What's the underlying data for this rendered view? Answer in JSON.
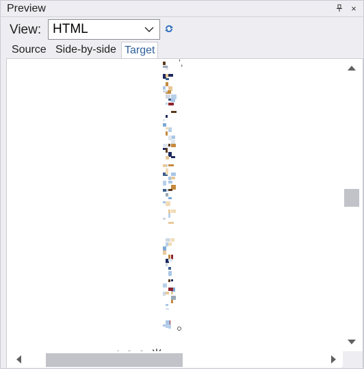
{
  "panel": {
    "title": "Preview",
    "pin_icon": "pin-icon",
    "close_icon": "close-icon"
  },
  "view": {
    "label": "View:",
    "selected": "HTML",
    "refresh_icon": "refresh-icon"
  },
  "tabs": [
    {
      "label": "Source",
      "active": false
    },
    {
      "label": "Side-by-side",
      "active": false
    },
    {
      "label": "Target",
      "active": true
    }
  ],
  "content": {
    "caption": "4.2.9  光",
    "comma": "’,"
  },
  "colors": {
    "panel_bg": "#eeeef2",
    "active_tab_text": "#2f5f9a",
    "scroll_thumb": "#c2c3c9"
  }
}
